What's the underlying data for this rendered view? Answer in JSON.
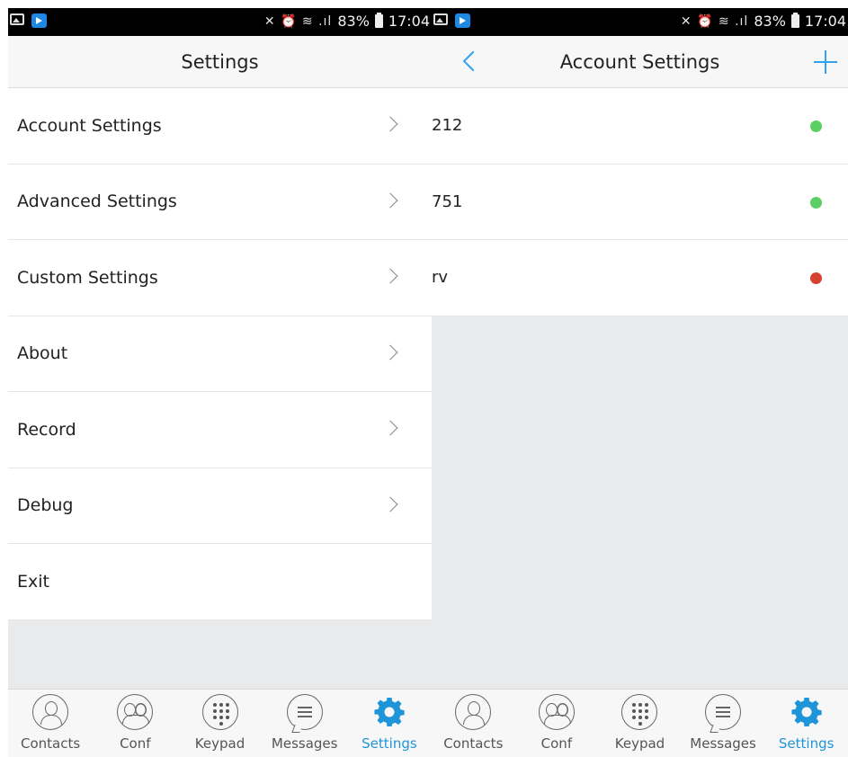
{
  "status_bar": {
    "battery": "83%",
    "time": "17:04",
    "signal": "⌀ ⌁ .∥"
  },
  "left": {
    "title": "Settings",
    "items": [
      {
        "label": "Account Settings",
        "chevron": true
      },
      {
        "label": "Advanced Settings",
        "chevron": true
      },
      {
        "label": "Custom Settings",
        "chevron": true
      },
      {
        "label": "About",
        "chevron": true
      },
      {
        "label": "Record",
        "chevron": true
      },
      {
        "label": "Debug",
        "chevron": true
      },
      {
        "label": "Exit",
        "chevron": false
      }
    ]
  },
  "right": {
    "title": "Account Settings",
    "accounts": [
      {
        "label": "212",
        "status_color": "#5ccf64"
      },
      {
        "label": "751",
        "status_color": "#5ccf64"
      },
      {
        "label": "rv",
        "status_color": "#d8412f"
      }
    ]
  },
  "tabs": [
    {
      "label": "Contacts",
      "icon": "contacts-icon"
    },
    {
      "label": "Conf",
      "icon": "conf-icon"
    },
    {
      "label": "Keypad",
      "icon": "keypad-icon"
    },
    {
      "label": "Messages",
      "icon": "messages-icon"
    },
    {
      "label": "Settings",
      "icon": "settings-icon",
      "active": true
    }
  ],
  "colors": {
    "accent": "#1e95d9",
    "title_bar": "#f7f7f7",
    "background": "#e8eaeb"
  }
}
